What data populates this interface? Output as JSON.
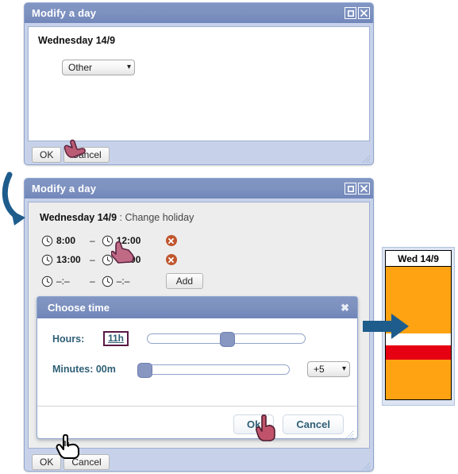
{
  "window1": {
    "title": "Modify a day",
    "controls": {
      "maximize": "maximize-icon",
      "close": "close-icon"
    },
    "day_label": "Wednesday 14/9",
    "category_select": {
      "value": "Other",
      "caret": "chevron-down-icon"
    },
    "footer": {
      "ok": "OK",
      "cancel": "Cancel"
    }
  },
  "window2": {
    "title": "Modify a day",
    "controls": {
      "maximize": "maximize-icon",
      "close": "close-icon"
    },
    "day_label": "Wednesday 14/9",
    "day_separator": " : ",
    "day_action": "Change holiday",
    "time_rows": [
      {
        "start": "8:00",
        "separator": "–",
        "end": "12:00",
        "delete": "delete-icon"
      },
      {
        "start": "13:00",
        "separator": "–",
        "end": "17:00",
        "delete": "delete-icon"
      },
      {
        "start": "–:–",
        "separator": "–",
        "end": "–:–",
        "add_label": "Add"
      }
    ],
    "footer": {
      "ok": "OK",
      "cancel": "Cancel"
    }
  },
  "dialog": {
    "title": "Choose time",
    "close": "✖",
    "hours": {
      "label": "Hours:",
      "value": "11h",
      "slider_percent": 48,
      "min": 0,
      "max": 23
    },
    "minutes": {
      "label": "Minutes: 00m",
      "value": "00m",
      "slider_percent": 0,
      "min": 0,
      "max": 59
    },
    "step_select": {
      "value": "+5",
      "caret": "chevron-down-icon"
    },
    "buttons": {
      "ok": "Ok",
      "cancel": "Cancel"
    }
  },
  "calendar": {
    "header": "Wed 14/9",
    "colors": {
      "busy": "#FFA313",
      "free": "#FFFFFF",
      "highlight": "#E50012"
    },
    "segments": [
      {
        "name": "busy-morning",
        "color": "#FFA313",
        "top_pct": 0,
        "height_pct": 50
      },
      {
        "name": "free-gap",
        "color": "#FFFFFF",
        "top_pct": 50,
        "height_pct": 9
      },
      {
        "name": "highlight",
        "color": "#E50012",
        "top_pct": 59,
        "height_pct": 11
      },
      {
        "name": "busy-evening",
        "color": "#FFA313",
        "top_pct": 70,
        "height_pct": 30
      }
    ]
  },
  "annotations": {
    "curved_arrow": "curved-arrow-down-icon",
    "straight_arrow": "arrow-right-icon",
    "arrow_color": "#1E5C8C"
  },
  "cursors": {
    "pink_hand": "pointing-hand-cursor",
    "white_hand": "pointing-hand-cursor"
  }
}
